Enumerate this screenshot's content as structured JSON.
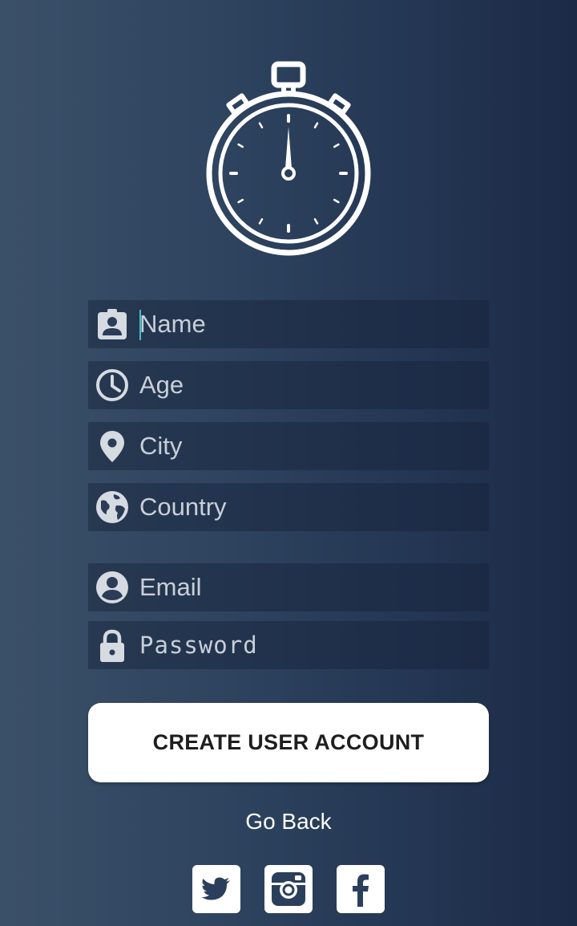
{
  "logo": {
    "icon": "stopwatch-icon"
  },
  "form": {
    "name": {
      "placeholder": "Name",
      "value": "",
      "icon": "contact-badge-icon"
    },
    "age": {
      "placeholder": "Age",
      "value": "",
      "icon": "clock-icon"
    },
    "city": {
      "placeholder": "City",
      "value": "",
      "icon": "location-pin-icon"
    },
    "country": {
      "placeholder": "Country",
      "value": "",
      "icon": "globe-icon"
    },
    "email": {
      "placeholder": "Email",
      "value": "",
      "icon": "account-circle-icon"
    },
    "password": {
      "placeholder": "Password",
      "value": "",
      "icon": "lock-icon"
    }
  },
  "actions": {
    "create_label": "CREATE USER ACCOUNT",
    "go_back_label": "Go Back"
  },
  "social": [
    {
      "icon": "twitter-icon"
    },
    {
      "icon": "instagram-icon"
    },
    {
      "icon": "facebook-icon"
    }
  ],
  "colors": {
    "background_start": "#3b5068",
    "background_end": "#1c2a46",
    "field_background": "#1e2d4a",
    "caret": "#3fc1c9",
    "button": "#ffffff",
    "icon": "#d6dae1"
  }
}
